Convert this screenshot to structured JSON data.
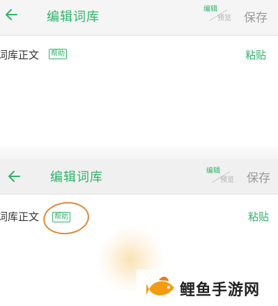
{
  "colors": {
    "accent": "#2fb36a",
    "highlight_circle": "#e08a3a",
    "muted": "#9a9a9a"
  },
  "screens": [
    {
      "header": {
        "back_icon": "arrow-left-icon",
        "title": "编辑词库",
        "toggle_edit": "编辑",
        "toggle_preview": "预览",
        "save": "保存"
      },
      "content": {
        "label": "词库正文",
        "help": "帮助",
        "paste": "粘贴"
      }
    },
    {
      "header": {
        "back_icon": "arrow-left-icon",
        "title": "编辑词库",
        "toggle_edit": "编辑",
        "toggle_preview": "预览",
        "save": "保存"
      },
      "content": {
        "label": "词库正文",
        "help": "帮助",
        "paste": "粘贴"
      }
    }
  ],
  "watermark": {
    "logo_icon": "fish-logo-icon",
    "text": "鲤鱼手游网"
  }
}
